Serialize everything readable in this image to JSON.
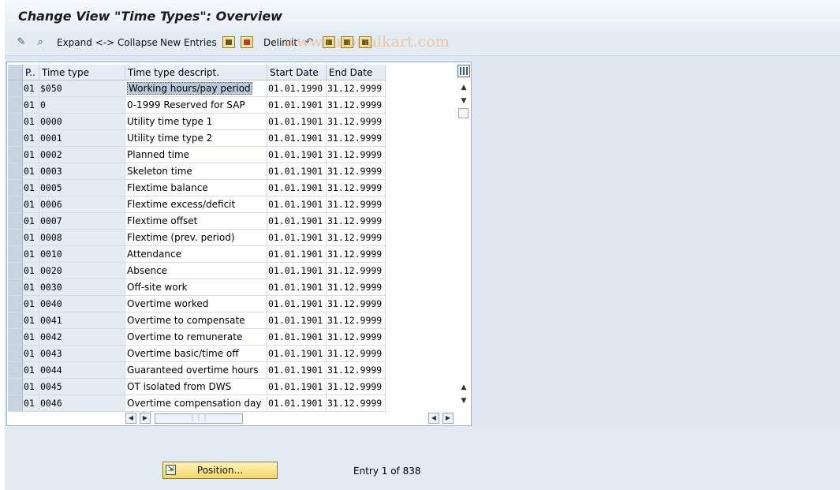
{
  "window": {
    "title": "Change View \"Time Types\": Overview"
  },
  "toolbar": {
    "expand_collapse": "Expand <-> Collapse",
    "new_entries": "New Entries",
    "delimit": "Delimit"
  },
  "watermark": "www.tutorialkart.com",
  "table": {
    "columns": [
      "P..",
      "Time type",
      "Time type descript.",
      "Start Date",
      "End Date"
    ],
    "rows": [
      {
        "p": "01",
        "type": "$050",
        "desc": "Working hours/pay period",
        "start": "01.01.1990",
        "end": "31.12.9999"
      },
      {
        "p": "01",
        "type": "0",
        "desc": "0-1999 Reserved for SAP",
        "start": "01.01.1901",
        "end": "31.12.9999"
      },
      {
        "p": "01",
        "type": "0000",
        "desc": "Utility time type 1",
        "start": "01.01.1901",
        "end": "31.12.9999"
      },
      {
        "p": "01",
        "type": "0001",
        "desc": "Utility time type 2",
        "start": "01.01.1901",
        "end": "31.12.9999"
      },
      {
        "p": "01",
        "type": "0002",
        "desc": "Planned time",
        "start": "01.01.1901",
        "end": "31.12.9999"
      },
      {
        "p": "01",
        "type": "0003",
        "desc": "Skeleton time",
        "start": "01.01.1901",
        "end": "31.12.9999"
      },
      {
        "p": "01",
        "type": "0005",
        "desc": "Flextime balance",
        "start": "01.01.1901",
        "end": "31.12.9999"
      },
      {
        "p": "01",
        "type": "0006",
        "desc": "Flextime excess/deficit",
        "start": "01.01.1901",
        "end": "31.12.9999"
      },
      {
        "p": "01",
        "type": "0007",
        "desc": "Flextime offset",
        "start": "01.01.1901",
        "end": "31.12.9999"
      },
      {
        "p": "01",
        "type": "0008",
        "desc": "Flextime (prev. period)",
        "start": "01.01.1901",
        "end": "31.12.9999"
      },
      {
        "p": "01",
        "type": "0010",
        "desc": "Attendance",
        "start": "01.01.1901",
        "end": "31.12.9999"
      },
      {
        "p": "01",
        "type": "0020",
        "desc": "Absence",
        "start": "01.01.1901",
        "end": "31.12.9999"
      },
      {
        "p": "01",
        "type": "0030",
        "desc": "Off-site work",
        "start": "01.01.1901",
        "end": "31.12.9999"
      },
      {
        "p": "01",
        "type": "0040",
        "desc": "Overtime worked",
        "start": "01.01.1901",
        "end": "31.12.9999"
      },
      {
        "p": "01",
        "type": "0041",
        "desc": "Overtime to compensate",
        "start": "01.01.1901",
        "end": "31.12.9999"
      },
      {
        "p": "01",
        "type": "0042",
        "desc": "Overtime to remunerate",
        "start": "01.01.1901",
        "end": "31.12.9999"
      },
      {
        "p": "01",
        "type": "0043",
        "desc": "Overtime basic/time off",
        "start": "01.01.1901",
        "end": "31.12.9999"
      },
      {
        "p": "01",
        "type": "0044",
        "desc": "Guaranteed overtime hours",
        "start": "01.01.1901",
        "end": "31.12.9999"
      },
      {
        "p": "01",
        "type": "0045",
        "desc": "OT isolated from DWS",
        "start": "01.01.1901",
        "end": "31.12.9999"
      },
      {
        "p": "01",
        "type": "0046",
        "desc": "Overtime compensation day",
        "start": "01.01.1901",
        "end": "31.12.9999"
      }
    ]
  },
  "footer": {
    "position_button": "Position...",
    "entry_info": "Entry 1 of 838"
  },
  "icons": {
    "display_change": "pencil-glasses-icon",
    "find": "find-icon",
    "copy": "copy-icon",
    "delete": "delete-icon",
    "undo": "undo-icon",
    "select_all": "select-all-icon",
    "select_block": "select-block-icon",
    "deselect_all": "deselect-all-icon",
    "column_settings": "table-settings-icon"
  }
}
